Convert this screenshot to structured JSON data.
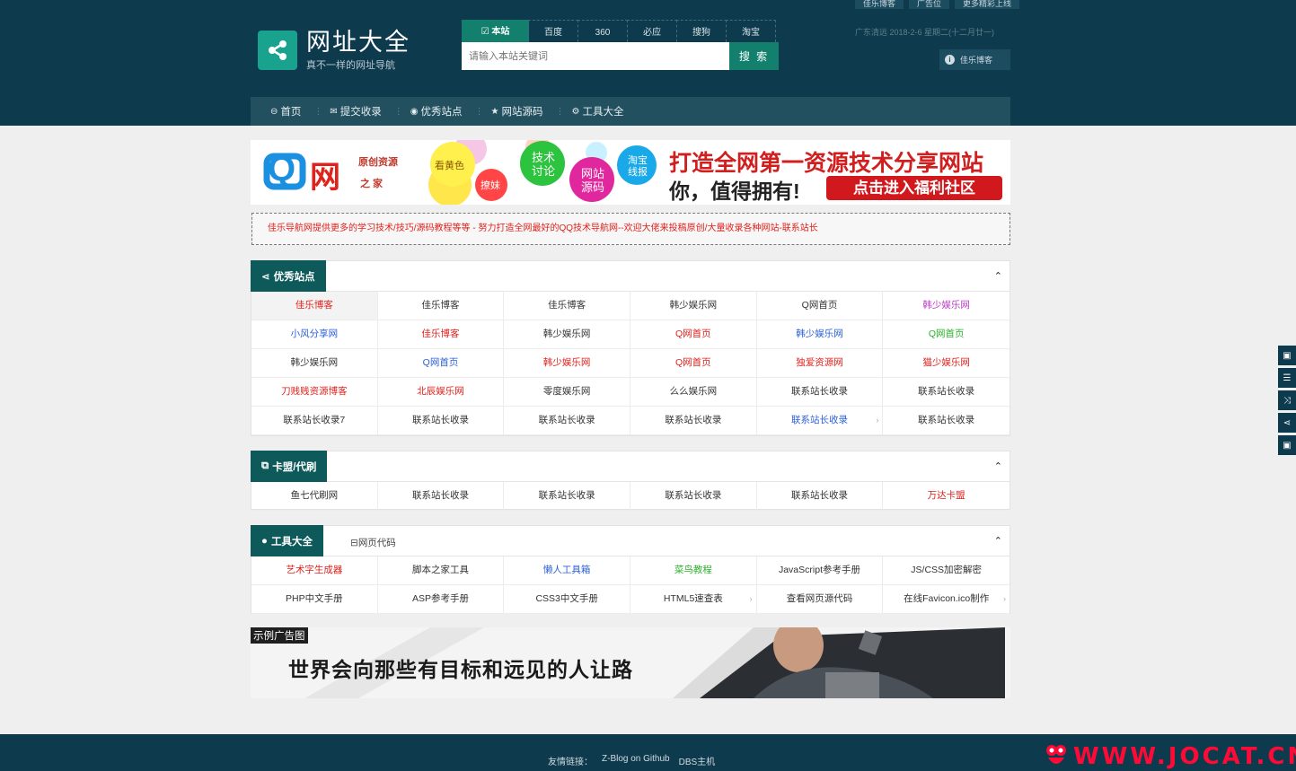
{
  "top_links": [
    "佳乐博客",
    "广告位",
    "更多精彩上线"
  ],
  "logo": {
    "title": "网址大全",
    "subtitle": "真不一样的网址导航"
  },
  "search": {
    "tabs": [
      "本站",
      "百度",
      "360",
      "必应",
      "搜狗",
      "淘宝"
    ],
    "placeholder": "请输入本站关键词",
    "button": "搜 索"
  },
  "date_text": "广东清远  2018-2-6  星期二(十二月廿一)",
  "user_button": "佳乐博客",
  "nav": [
    "首页",
    "提交收录",
    "优秀站点",
    "网站源码",
    "工具大全"
  ],
  "banner": {
    "logo_q": "Q",
    "logo_wang": "网",
    "logo_side1": "原创资源",
    "logo_side2": "之  家",
    "bubbles": [
      "看黄色",
      "撩妹",
      "技术讨论",
      "网站源码",
      "淘宝线报"
    ],
    "headline1": "打造全网第一资源技术分享网站",
    "headline2": "你，值得拥有!",
    "cta": "点击进入福利社区"
  },
  "notice": "佳乐导航网提供更多的学习技术/技巧/源码教程等等 - 努力打造全网最好的QQ技术导航网--欢迎大佬来投稿原创/大量收录各种网站-联系站长",
  "sections": {
    "featured": {
      "title": "优秀站点",
      "items": [
        {
          "label": "佳乐博客",
          "color": "#e0221c",
          "hl": true
        },
        {
          "label": "佳乐博客",
          "color": "#333333"
        },
        {
          "label": "佳乐博客",
          "color": "#333333"
        },
        {
          "label": "韩少娱乐网",
          "color": "#333333"
        },
        {
          "label": "Q网首页",
          "color": "#333333"
        },
        {
          "label": "韩少娱乐网",
          "color": "#b93cc8"
        },
        {
          "label": "小风分享网",
          "color": "#2b5fd9"
        },
        {
          "label": "佳乐博客",
          "color": "#e0221c"
        },
        {
          "label": "韩少娱乐网",
          "color": "#333333"
        },
        {
          "label": "Q网首页",
          "color": "#e0221c"
        },
        {
          "label": "韩少娱乐网",
          "color": "#2b5fd9"
        },
        {
          "label": "Q网首页",
          "color": "#2bb22b"
        },
        {
          "label": "韩少娱乐网",
          "color": "#333333"
        },
        {
          "label": "Q网首页",
          "color": "#2b5fd9"
        },
        {
          "label": "韩少娱乐网",
          "color": "#e0221c"
        },
        {
          "label": "Q网首页",
          "color": "#e0221c"
        },
        {
          "label": "独爱资源网",
          "color": "#e0221c"
        },
        {
          "label": "猫少娱乐网",
          "color": "#e0221c"
        },
        {
          "label": "刀贱贱资源博客",
          "color": "#e0221c"
        },
        {
          "label": "北辰娱乐网",
          "color": "#e0221c"
        },
        {
          "label": "零度娱乐网",
          "color": "#333333"
        },
        {
          "label": "么么娱乐网",
          "color": "#333333"
        },
        {
          "label": "联系站长收录",
          "color": "#333333"
        },
        {
          "label": "联系站长收录",
          "color": "#333333"
        },
        {
          "label": "联系站长收录7",
          "color": "#333333"
        },
        {
          "label": "联系站长收录",
          "color": "#333333"
        },
        {
          "label": "联系站长收录",
          "color": "#333333"
        },
        {
          "label": "联系站长收录",
          "color": "#333333"
        },
        {
          "label": "联系站长收录",
          "color": "#2b5fd9",
          "arrow": true
        },
        {
          "label": "联系站长收录",
          "color": "#333333"
        }
      ]
    },
    "cards": {
      "title": "卡盟/代刷",
      "items": [
        {
          "label": "鱼七代刷网",
          "color": "#333333"
        },
        {
          "label": "联系站长收录",
          "color": "#333333"
        },
        {
          "label": "联系站长收录",
          "color": "#333333"
        },
        {
          "label": "联系站长收录",
          "color": "#333333"
        },
        {
          "label": "联系站长收录",
          "color": "#333333"
        },
        {
          "label": "万达卡盟",
          "color": "#e0221c"
        }
      ]
    },
    "tools": {
      "title": "工具大全",
      "subtab": "网页代码",
      "items": [
        {
          "label": "艺术字生成器",
          "color": "#e0221c"
        },
        {
          "label": "脚本之家工具",
          "color": "#333333"
        },
        {
          "label": "懒人工具箱",
          "color": "#2b5fd9"
        },
        {
          "label": "菜鸟教程",
          "color": "#2bb22b"
        },
        {
          "label": "JavaScript参考手册",
          "color": "#333333"
        },
        {
          "label": "JS/CSS加密解密",
          "color": "#333333"
        },
        {
          "label": "PHP中文手册",
          "color": "#333333"
        },
        {
          "label": "ASP参考手册",
          "color": "#333333"
        },
        {
          "label": "CSS3中文手册",
          "color": "#333333"
        },
        {
          "label": "HTML5速查表",
          "color": "#333333",
          "arrow": true
        },
        {
          "label": "查看网页源代码",
          "color": "#333333"
        },
        {
          "label": "在线Favicon.ico制作",
          "color": "#333333",
          "arrow": true
        }
      ]
    }
  },
  "ad": {
    "label": "示例广告图",
    "text": "世界会向那些有目标和远见的人让路"
  },
  "footer": {
    "label": "友情链接：",
    "links": [
      "Z-Blog on Github",
      "DBS主机"
    ]
  },
  "watermark": "WWW.JOCAT.CN",
  "colors": {
    "header_bg": "#0e3a4d",
    "accent": "#12806d",
    "section_title": "#0e5a5a"
  }
}
